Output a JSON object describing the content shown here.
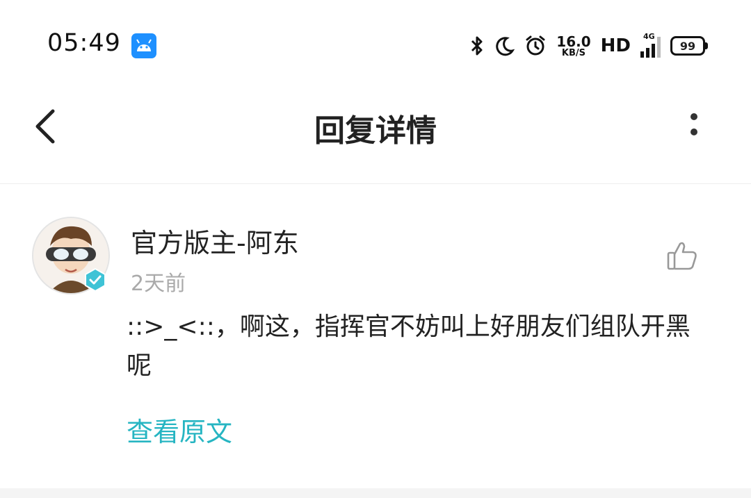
{
  "status_bar": {
    "time": "05:49",
    "net_speed": "16.0",
    "net_unit": "KB/S",
    "hd": "HD",
    "network": "4G",
    "battery": "99",
    "icons": [
      "android-icon",
      "bluetooth-icon",
      "moon-icon",
      "alarm-icon",
      "signal-icon",
      "battery-icon"
    ]
  },
  "header": {
    "title": "回复详情"
  },
  "reply": {
    "author": "官方版主-阿东",
    "time": "2天前",
    "content": "::>_<::，啊这，指挥官不妨叫上好朋友们组队开黑呢",
    "view_original": "查看原文"
  },
  "colors": {
    "accent": "#26b5c2",
    "badge": "#1e90ff",
    "muted": "#aaaaaa"
  }
}
